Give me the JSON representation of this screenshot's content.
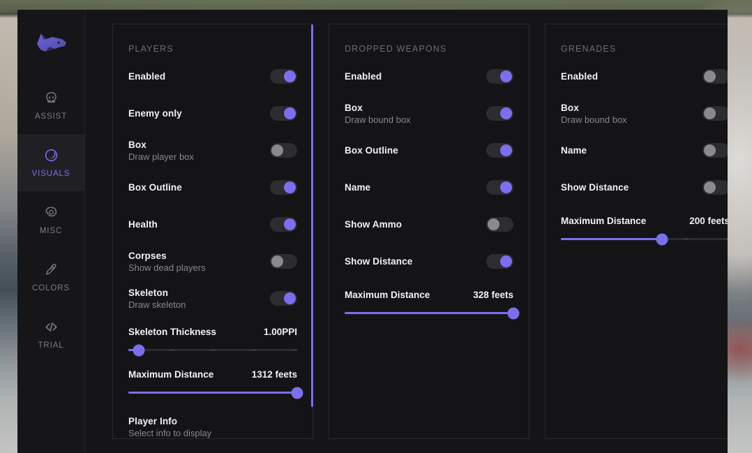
{
  "app": {
    "logo_icon": "wolf-head-logo"
  },
  "sidebar": {
    "items": [
      {
        "label": "ASSIST",
        "icon": "skull-icon",
        "active": false
      },
      {
        "label": "VISUALS",
        "icon": "eye-crescent-icon",
        "active": true
      },
      {
        "label": "MISC",
        "icon": "gear-icon",
        "active": false
      },
      {
        "label": "COLORS",
        "icon": "eyedropper-icon",
        "active": false
      },
      {
        "label": "TRIAL",
        "icon": "code-icon",
        "active": false
      }
    ]
  },
  "colors": {
    "accent": "#7b6ff0",
    "toggle_off_knob": "#8a8a8e",
    "toggle_track": "#2c2c31",
    "panel_bg": "#141416",
    "panel_border": "#2a2a2e",
    "window_bg": "#151517",
    "sidebar_bg": "#161618",
    "label": "#f2f2f4",
    "sublabel": "#88888e",
    "section_title": "#6d6d73"
  },
  "panels": [
    {
      "title": "PLAYERS",
      "rows": [
        {
          "label": "Enabled",
          "sub": "",
          "toggle": "on"
        },
        {
          "label": "Enemy only",
          "sub": "",
          "toggle": "on"
        },
        {
          "label": "Box",
          "sub": "Draw player box",
          "toggle": "off"
        },
        {
          "label": "Box Outline",
          "sub": "",
          "toggle": "on"
        },
        {
          "label": "Health",
          "sub": "",
          "toggle": "on"
        },
        {
          "label": "Corpses",
          "sub": "Show dead players",
          "toggle": "off"
        },
        {
          "label": "Skeleton",
          "sub": "Draw skeleton",
          "toggle": "on"
        }
      ],
      "sliders": [
        {
          "label": "Skeleton Thickness",
          "value": "1.00PPI",
          "percent": 6
        },
        {
          "label": "Maximum Distance",
          "value": "1312 feets",
          "percent": 100
        }
      ],
      "info": {
        "label": "Player Info",
        "sub": "Select info to display"
      },
      "scrollbar": true
    },
    {
      "title": "DROPPED WEAPONS",
      "rows": [
        {
          "label": "Enabled",
          "sub": "",
          "toggle": "on"
        },
        {
          "label": "Box",
          "sub": "Draw bound box",
          "toggle": "on"
        },
        {
          "label": "Box Outline",
          "sub": "",
          "toggle": "on"
        },
        {
          "label": "Name",
          "sub": "",
          "toggle": "on"
        },
        {
          "label": "Show Ammo",
          "sub": "",
          "toggle": "off"
        },
        {
          "label": "Show Distance",
          "sub": "",
          "toggle": "on"
        }
      ],
      "sliders": [
        {
          "label": "Maximum Distance",
          "value": "328 feets",
          "percent": 100
        }
      ],
      "info": null,
      "scrollbar": false
    },
    {
      "title": "GRENADES",
      "rows": [
        {
          "label": "Enabled",
          "sub": "",
          "toggle": "off"
        },
        {
          "label": "Box",
          "sub": "Draw bound box",
          "toggle": "off"
        },
        {
          "label": "Name",
          "sub": "",
          "toggle": "off"
        },
        {
          "label": "Show Distance",
          "sub": "",
          "toggle": "off"
        }
      ],
      "sliders": [
        {
          "label": "Maximum Distance",
          "value": "200 feets",
          "percent": 60
        }
      ],
      "info": null,
      "scrollbar": false
    }
  ]
}
